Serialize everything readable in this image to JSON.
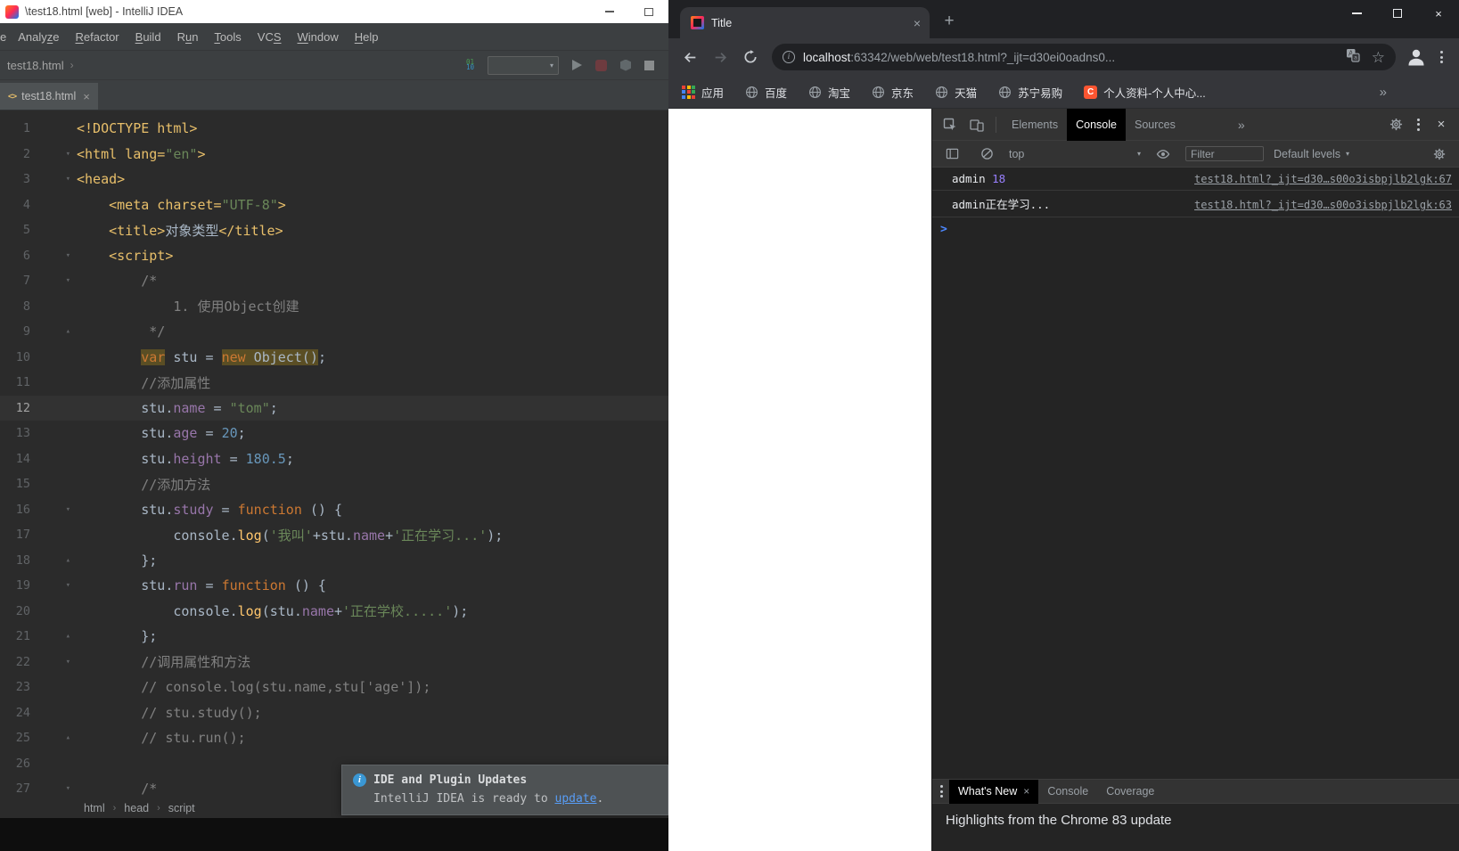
{
  "colors": {
    "accent_link_blue": "#589df6",
    "console_prompt_blue": "#4d88ff",
    "csdn_red": "#fc5531",
    "editor_highlight": "#5a4e24"
  },
  "ide": {
    "title": "\\test18.html [web] - IntelliJ IDEA",
    "menu": {
      "partial_item": "e",
      "items": [
        {
          "label": "Analyze",
          "mnemonic": 5
        },
        {
          "label": "Refactor",
          "mnemonic": 0
        },
        {
          "label": "Build",
          "mnemonic": 0
        },
        {
          "label": "Run",
          "mnemonic": 1
        },
        {
          "label": "Tools",
          "mnemonic": 0
        },
        {
          "label": "VCS",
          "mnemonic": 2
        },
        {
          "label": "Window",
          "mnemonic": 0
        },
        {
          "label": "Help",
          "mnemonic": 0
        }
      ]
    },
    "nav": {
      "file": "test18.html"
    },
    "tab": {
      "label": "test18.html"
    },
    "editor": {
      "lines": [
        {
          "fold": "",
          "tokens": [
            [
              "tag",
              "<!DOCTYPE html>"
            ]
          ]
        },
        {
          "fold": "d",
          "tokens": [
            [
              "tag",
              "<html lang="
            ],
            [
              "str",
              "\"en\""
            ],
            [
              "tag",
              ">"
            ]
          ]
        },
        {
          "fold": "d",
          "tokens": [
            [
              "tag",
              "<head>"
            ]
          ]
        },
        {
          "fold": "",
          "tokens": [
            [
              "tag",
              "    <meta charset="
            ],
            [
              "str",
              "\"UTF-8\""
            ],
            [
              "tag",
              ">"
            ]
          ]
        },
        {
          "fold": "",
          "tokens": [
            [
              "tag",
              "    <title>"
            ],
            [
              "txt",
              "对象类型"
            ],
            [
              "tag",
              "</title>"
            ]
          ]
        },
        {
          "fold": "d",
          "tokens": [
            [
              "tag",
              "    <script>"
            ]
          ]
        },
        {
          "fold": "d",
          "tokens": [
            [
              "cmt",
              "        /*"
            ]
          ]
        },
        {
          "fold": "",
          "tokens": [
            [
              "cmt",
              "            1. 使用Object创建"
            ]
          ]
        },
        {
          "fold": "u",
          "tokens": [
            [
              "cmt",
              "         */"
            ]
          ]
        },
        {
          "fold": "",
          "tokens": [
            [
              "txt",
              "        "
            ],
            [
              "hlkw",
              "var"
            ],
            [
              "txt",
              " stu = "
            ],
            [
              "hlkw",
              "new"
            ],
            [
              "hltxt",
              " Object()"
            ],
            [
              "txt",
              ";"
            ]
          ]
        },
        {
          "fold": "",
          "tokens": [
            [
              "cmt",
              "        //添加属性"
            ]
          ]
        },
        {
          "fold": "",
          "caret": true,
          "tokens": [
            [
              "txt",
              "        stu."
            ],
            [
              "fld",
              "name"
            ],
            [
              "txt",
              " = "
            ],
            [
              "str",
              "\"tom\""
            ],
            [
              "txt",
              ";"
            ]
          ]
        },
        {
          "fold": "",
          "tokens": [
            [
              "txt",
              "        stu."
            ],
            [
              "fld",
              "age"
            ],
            [
              "txt",
              " = "
            ],
            [
              "num",
              "20"
            ],
            [
              "txt",
              ";"
            ]
          ]
        },
        {
          "fold": "",
          "tokens": [
            [
              "txt",
              "        stu."
            ],
            [
              "fld",
              "height"
            ],
            [
              "txt",
              " = "
            ],
            [
              "num",
              "180.5"
            ],
            [
              "txt",
              ";"
            ]
          ]
        },
        {
          "fold": "",
          "tokens": [
            [
              "cmt",
              "        //添加方法"
            ]
          ]
        },
        {
          "fold": "d",
          "tokens": [
            [
              "txt",
              "        stu."
            ],
            [
              "fld",
              "study"
            ],
            [
              "txt",
              " = "
            ],
            [
              "kw",
              "function"
            ],
            [
              "txt",
              " () {"
            ]
          ]
        },
        {
          "fold": "",
          "tokens": [
            [
              "txt",
              "            console."
            ],
            [
              "fn",
              "log"
            ],
            [
              "txt",
              "("
            ],
            [
              "str",
              "'我叫'"
            ],
            [
              "txt",
              "+stu."
            ],
            [
              "fld",
              "name"
            ],
            [
              "txt",
              "+"
            ],
            [
              "str",
              "'正在学习...'"
            ],
            [
              "txt",
              ");"
            ]
          ]
        },
        {
          "fold": "u",
          "tokens": [
            [
              "txt",
              "        };"
            ]
          ]
        },
        {
          "fold": "d",
          "tokens": [
            [
              "txt",
              "        stu."
            ],
            [
              "fld",
              "run"
            ],
            [
              "txt",
              " = "
            ],
            [
              "kw",
              "function"
            ],
            [
              "txt",
              " () {"
            ]
          ]
        },
        {
          "fold": "",
          "tokens": [
            [
              "txt",
              "            console."
            ],
            [
              "fn",
              "log"
            ],
            [
              "txt",
              "(stu."
            ],
            [
              "fld",
              "name"
            ],
            [
              "txt",
              "+"
            ],
            [
              "str",
              "'正在学校.....'"
            ],
            [
              "txt",
              ");"
            ]
          ]
        },
        {
          "fold": "u",
          "tokens": [
            [
              "txt",
              "        };"
            ]
          ]
        },
        {
          "fold": "d",
          "tokens": [
            [
              "cmt",
              "        //调用属性和方法"
            ]
          ]
        },
        {
          "fold": "",
          "tokens": [
            [
              "cmt",
              "        // console.log(stu.name,stu['age']);"
            ]
          ]
        },
        {
          "fold": "",
          "tokens": [
            [
              "cmt",
              "        // stu.study();"
            ]
          ]
        },
        {
          "fold": "u",
          "tokens": [
            [
              "cmt",
              "        // stu.run();"
            ]
          ]
        },
        {
          "fold": "",
          "tokens": []
        },
        {
          "fold": "d",
          "tokens": [
            [
              "cmt",
              "        /*"
            ]
          ]
        }
      ],
      "breadcrumbs": [
        "html",
        "head",
        "script"
      ]
    },
    "notification": {
      "title": "IDE and Plugin Updates",
      "body": "IntelliJ IDEA is ready to ",
      "link": "update",
      "suffix": "."
    }
  },
  "chrome": {
    "tab_title": "Title",
    "url": {
      "host": "localhost",
      "rest": ":63342/web/web/test18.html?_ijt=d30ei0oadns0..."
    },
    "bookmarks": [
      {
        "label": "应用",
        "icon": "apps-grid"
      },
      {
        "label": "百度",
        "icon": "globe"
      },
      {
        "label": "淘宝",
        "icon": "globe"
      },
      {
        "label": "京东",
        "icon": "globe"
      },
      {
        "label": "天猫",
        "icon": "globe"
      },
      {
        "label": "苏宁易购",
        "icon": "globe"
      },
      {
        "label": "个人资料-个人中心...",
        "icon": "csdn"
      }
    ],
    "bookmarks_overflow": "»",
    "devtools": {
      "tabs": [
        {
          "label": "Elements",
          "active": false
        },
        {
          "label": "Console",
          "active": true
        },
        {
          "label": "Sources",
          "active": false
        }
      ],
      "more_tabs": "»",
      "context_selector": "top",
      "filter_placeholder": "Filter",
      "levels_label": "Default levels",
      "console_rows": [
        {
          "parts": [
            [
              "plain",
              "admin "
            ],
            [
              "num",
              "18"
            ]
          ],
          "source": "test18.html?_ijt=d30…s00o3isbpjlb2lgk:67"
        },
        {
          "parts": [
            [
              "plain",
              "admin正在学习..."
            ]
          ],
          "source": "test18.html?_ijt=d30…s00o3isbpjlb2lgk:63"
        }
      ],
      "drawer": {
        "tabs": [
          {
            "label": "What's New",
            "active": true,
            "closable": true
          },
          {
            "label": "Console",
            "active": false
          },
          {
            "label": "Coverage",
            "active": false
          }
        ],
        "content_title": "Highlights from the Chrome 83 update"
      }
    }
  }
}
